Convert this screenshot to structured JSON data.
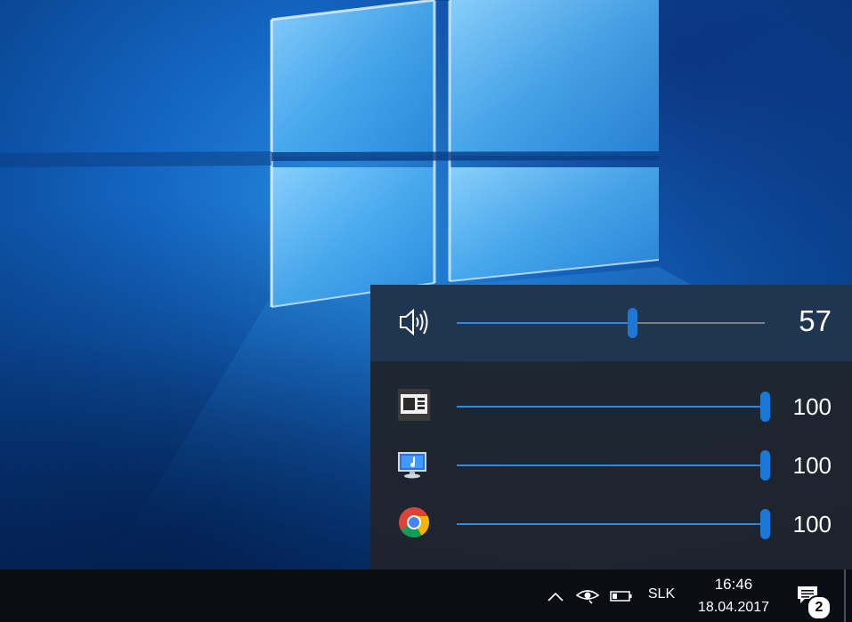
{
  "volume_flyout": {
    "master": {
      "icon": "speaker-icon",
      "level": 57,
      "value_text": "57"
    },
    "apps": [
      {
        "icon": "window-app-icon",
        "level": 100,
        "value_text": "100"
      },
      {
        "icon": "system-sounds-icon",
        "level": 100,
        "value_text": "100"
      },
      {
        "icon": "chrome-icon",
        "level": 100,
        "value_text": "100"
      }
    ],
    "colors": {
      "accent": "#1a78d6",
      "track": "#7d7d7d",
      "panel": "#1f242c",
      "master_panel": "#1f3550"
    }
  },
  "taskbar": {
    "tray_icons": [
      "chevron-up-icon",
      "network-eye-icon",
      "battery-icon"
    ],
    "language": "SLK",
    "time": "16:46",
    "date": "18.04.2017",
    "notification_count": "2"
  }
}
